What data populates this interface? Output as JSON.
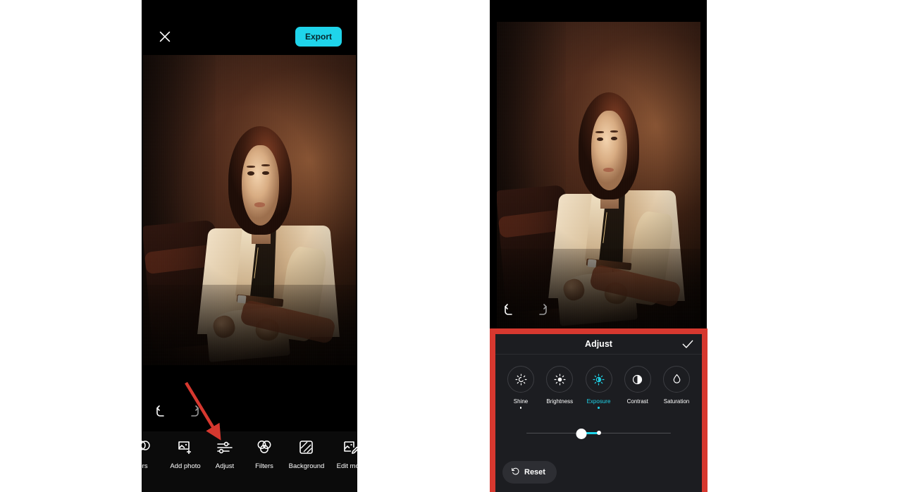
{
  "colors": {
    "accent_cyan": "#1fd4ea",
    "annotation_red": "#d6382f",
    "panel_bg": "#1c1d21",
    "phone_bg": "#000000",
    "label_white": "#ffffff"
  },
  "left_phone": {
    "topbar": {
      "close_icon": "close-x-icon",
      "export_label": "Export"
    },
    "history": {
      "undo_icon": "undo-arrow-icon",
      "redo_icon": "redo-arrow-icon"
    },
    "toolbar": {
      "items": [
        {
          "label": "ers",
          "icon": "filters-circles-icon",
          "truncated": true
        },
        {
          "label": "Add photo",
          "icon": "add-photo-icon"
        },
        {
          "label": "Adjust",
          "icon": "sliders-icon"
        },
        {
          "label": "Filters",
          "icon": "three-circles-icon"
        },
        {
          "label": "Background",
          "icon": "background-hatch-icon"
        },
        {
          "label": "Edit more",
          "icon": "edit-more-pencil-icon"
        }
      ]
    }
  },
  "right_phone": {
    "history": {
      "undo_icon": "undo-arrow-icon",
      "redo_icon": "redo-arrow-icon"
    },
    "adjust_panel": {
      "title": "Adjust",
      "confirm_icon": "checkmark-icon",
      "options": [
        {
          "label": "Shine",
          "icon": "shine-icon",
          "active": false,
          "has_dot": true
        },
        {
          "label": "Brightness",
          "icon": "brightness-icon",
          "active": false,
          "has_dot": false
        },
        {
          "label": "Exposure",
          "icon": "exposure-icon",
          "active": true,
          "has_dot": true
        },
        {
          "label": "Contrast",
          "icon": "contrast-icon",
          "active": false,
          "has_dot": false
        },
        {
          "label": "Saturation",
          "icon": "saturation-drop-icon",
          "active": false,
          "has_dot": false
        }
      ],
      "slider": {
        "thumb_percent": 38,
        "center_percent": 50,
        "min": -100,
        "max": 100
      },
      "reset": {
        "label": "Reset",
        "icon": "rotate-ccw-icon"
      }
    }
  },
  "annotation": {
    "arrow_color": "#d6382f",
    "points_to": "Adjust"
  }
}
